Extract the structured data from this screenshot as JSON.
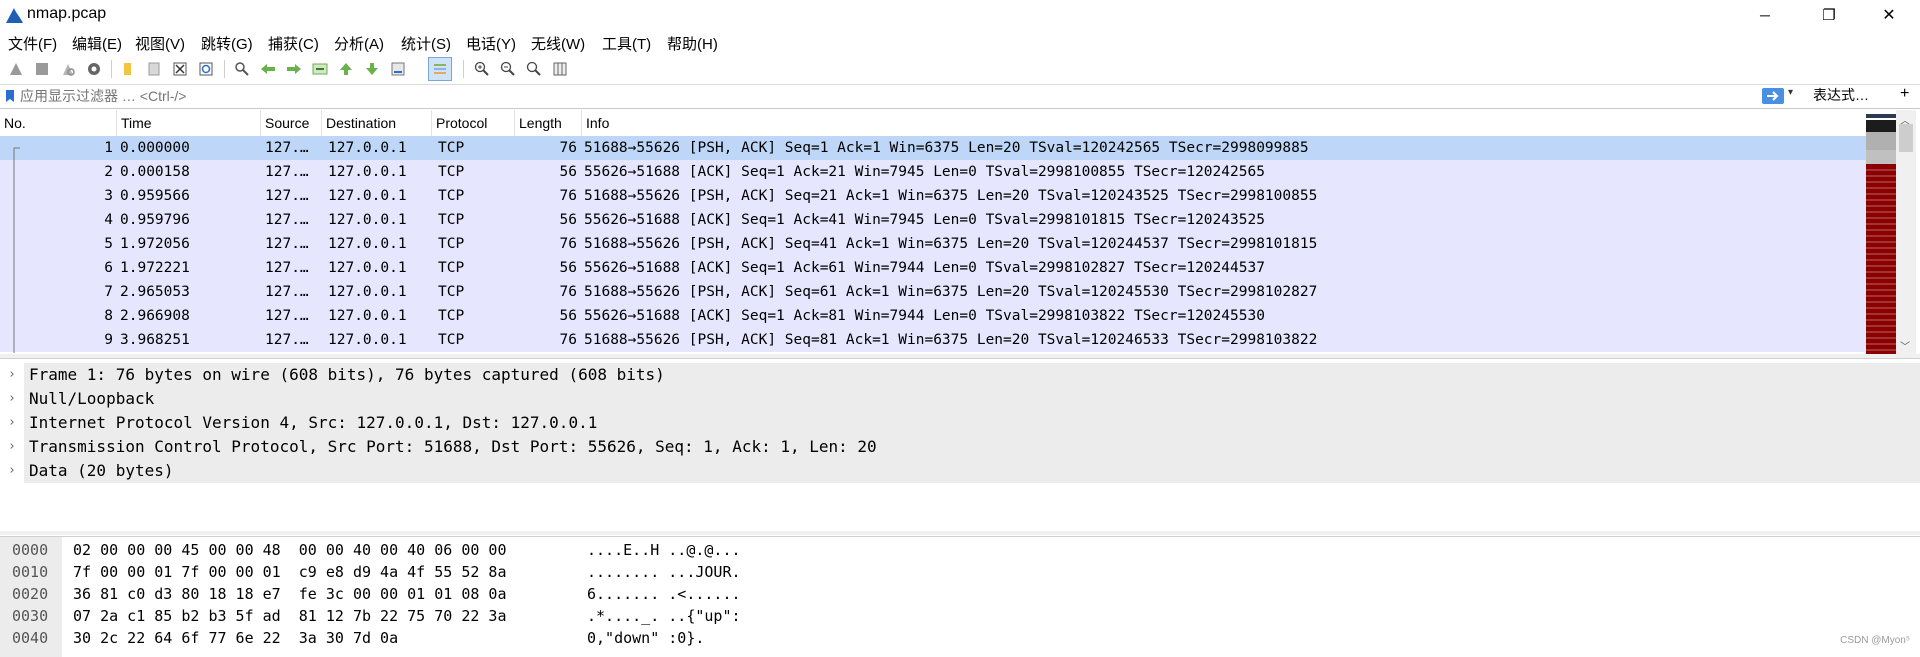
{
  "window": {
    "title": "nmap.pcap",
    "minimize_glyph": "─",
    "maximize_glyph": "❐",
    "close_glyph": "✕",
    "app_icon": "wireshark-fin-icon"
  },
  "menu": [
    "文件(F)",
    "编辑(E)",
    "视图(V)",
    "跳转(G)",
    "捕获(C)",
    "分析(A)",
    "统计(S)",
    "电话(Y)",
    "无线(W)",
    "工具(T)",
    "帮助(H)"
  ],
  "toolbar": {
    "icons": [
      "start-capture-icon",
      "stop-capture-icon",
      "restart-capture-icon",
      "capture-options-icon",
      "open-file-icon",
      "save-file-icon",
      "close-file-icon",
      "reload-file-icon",
      "find-packet-icon",
      "go-back-icon",
      "go-forward-icon",
      "go-to-packet-icon",
      "go-first-icon",
      "go-last-icon",
      "autoscroll-icon",
      "colorize-icon",
      "zoom-in-icon",
      "zoom-out-icon",
      "zoom-normal-icon",
      "resize-columns-icon"
    ]
  },
  "filter": {
    "placeholder": "应用显示过滤器 … <Ctrl-/>",
    "expression_label": "表达式…",
    "add_label": "+"
  },
  "packet_list": {
    "columns": [
      "No.",
      "Time",
      "Source",
      "Destination",
      "Protocol",
      "Length",
      "Info"
    ],
    "rows": [
      {
        "no": "1",
        "time": "0.000000",
        "src": "127.…",
        "dst": "127.0.0.1",
        "proto": "TCP",
        "len": "76",
        "info": "51688→55626 [PSH, ACK] Seq=1 Ack=1 Win=6375 Len=20 TSval=120242565 TSecr=2998099885"
      },
      {
        "no": "2",
        "time": "0.000158",
        "src": "127.…",
        "dst": "127.0.0.1",
        "proto": "TCP",
        "len": "56",
        "info": "55626→51688 [ACK] Seq=1 Ack=21 Win=7945 Len=0 TSval=2998100855 TSecr=120242565"
      },
      {
        "no": "3",
        "time": "0.959566",
        "src": "127.…",
        "dst": "127.0.0.1",
        "proto": "TCP",
        "len": "76",
        "info": "51688→55626 [PSH, ACK] Seq=21 Ack=1 Win=6375 Len=20 TSval=120243525 TSecr=2998100855"
      },
      {
        "no": "4",
        "time": "0.959796",
        "src": "127.…",
        "dst": "127.0.0.1",
        "proto": "TCP",
        "len": "56",
        "info": "55626→51688 [ACK] Seq=1 Ack=41 Win=7945 Len=0 TSval=2998101815 TSecr=120243525"
      },
      {
        "no": "5",
        "time": "1.972056",
        "src": "127.…",
        "dst": "127.0.0.1",
        "proto": "TCP",
        "len": "76",
        "info": "51688→55626 [PSH, ACK] Seq=41 Ack=1 Win=6375 Len=20 TSval=120244537 TSecr=2998101815"
      },
      {
        "no": "6",
        "time": "1.972221",
        "src": "127.…",
        "dst": "127.0.0.1",
        "proto": "TCP",
        "len": "56",
        "info": "55626→51688 [ACK] Seq=1 Ack=61 Win=7944 Len=0 TSval=2998102827 TSecr=120244537"
      },
      {
        "no": "7",
        "time": "2.965053",
        "src": "127.…",
        "dst": "127.0.0.1",
        "proto": "TCP",
        "len": "76",
        "info": "51688→55626 [PSH, ACK] Seq=61 Ack=1 Win=6375 Len=20 TSval=120245530 TSecr=2998102827"
      },
      {
        "no": "8",
        "time": "2.966908",
        "src": "127.…",
        "dst": "127.0.0.1",
        "proto": "TCP",
        "len": "56",
        "info": "55626→51688 [ACK] Seq=1 Ack=81 Win=7944 Len=0 TSval=2998103822 TSecr=120245530"
      },
      {
        "no": "9",
        "time": "3.968251",
        "src": "127.…",
        "dst": "127.0.0.1",
        "proto": "TCP",
        "len": "76",
        "info": "51688→55626 [PSH, ACK] Seq=81 Ack=1 Win=6375 Len=20 TSval=120246533 TSecr=2998103822"
      }
    ],
    "selected_row": 1,
    "selected_color": "#bed7f8",
    "row_color": "#e7e6ff"
  },
  "details": [
    "Frame 1: 76 bytes on wire (608 bits), 76 bytes captured (608 bits)",
    "Null/Loopback",
    "Internet Protocol Version 4, Src: 127.0.0.1, Dst: 127.0.0.1",
    "Transmission Control Protocol, Src Port: 51688, Dst Port: 55626, Seq: 1, Ack: 1, Len: 20",
    "Data (20 bytes)"
  ],
  "hex": [
    {
      "offset": "0000",
      "bytes": "02 00 00 00 45 00 00 48  00 00 40 00 40 06 00 00",
      "ascii": "....E..H ..@.@..."
    },
    {
      "offset": "0010",
      "bytes": "7f 00 00 01 7f 00 00 01  c9 e8 d9 4a 4f 55 52 8a",
      "ascii": "........ ...JOUR."
    },
    {
      "offset": "0020",
      "bytes": "36 81 c0 d3 80 18 18 e7  fe 3c 00 00 01 01 08 0a",
      "ascii": "6....... .<......"
    },
    {
      "offset": "0030",
      "bytes": "07 2a c1 85 b2 b3 5f ad  81 12 7b 22 75 70 22 3a",
      "ascii": ".*...._. ..{\"up\":"
    },
    {
      "offset": "0040",
      "bytes": "30 2c 22 64 6f 77 6e 22  3a 30 7d 0a",
      "ascii": "0,\"down\" :0}."
    }
  ],
  "watermark": "CSDN @Myon⁵"
}
